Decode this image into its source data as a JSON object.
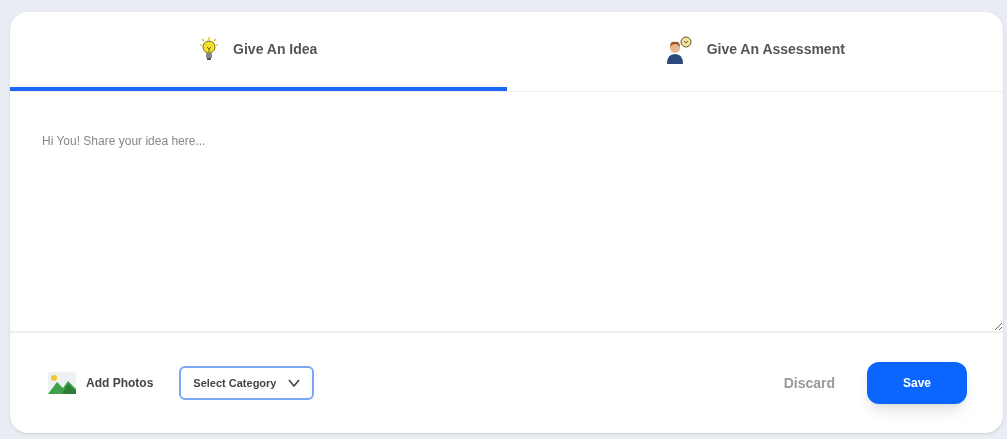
{
  "tabs": [
    {
      "label": "Give An Idea",
      "kind": "idea",
      "selected": true
    },
    {
      "label": "Give An Assessment",
      "kind": "assessment",
      "selected": false
    }
  ],
  "editor": {
    "placeholder": "Hi You! Share your idea here..."
  },
  "footer": {
    "add_photos": "Add Photos",
    "category": "Select Category",
    "discard": "Discard",
    "save": "Save"
  }
}
